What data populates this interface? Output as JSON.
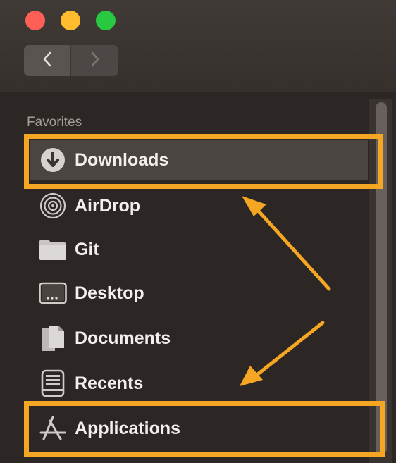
{
  "window": {
    "traffic_lights": [
      "close",
      "minimize",
      "zoom"
    ],
    "nav": {
      "back_icon": "chevron-left-icon",
      "forward_icon": "chevron-right-icon"
    }
  },
  "sidebar": {
    "section_title": "Favorites",
    "items": [
      {
        "label": "Downloads",
        "icon": "download-icon",
        "selected": true
      },
      {
        "label": "AirDrop",
        "icon": "airdrop-icon"
      },
      {
        "label": "Git",
        "icon": "folder-icon"
      },
      {
        "label": "Desktop",
        "icon": "desktop-icon"
      },
      {
        "label": "Documents",
        "icon": "documents-icon"
      },
      {
        "label": "Recents",
        "icon": "recents-icon"
      },
      {
        "label": "Applications",
        "icon": "applications-icon"
      }
    ]
  },
  "annotations": {
    "highlighted": [
      "Downloads",
      "Applications"
    ],
    "color": "#f5a623"
  },
  "colors": {
    "close": "#fe5f57",
    "minimize": "#febc2e",
    "zoom": "#28c840",
    "sidebar_bg": "#2c2725",
    "selected_bg": "#4b4542",
    "highlight": "#f5a623"
  }
}
